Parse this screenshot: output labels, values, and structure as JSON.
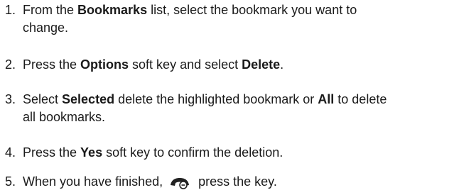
{
  "steps": [
    {
      "number": "1.",
      "line1": [
        "From the ",
        "Bookmarks",
        " list, select the bookmark you want to"
      ],
      "line2": [
        "change."
      ]
    },
    {
      "number": "2.",
      "line1": [
        "Press the ",
        "Options",
        " soft key and select ",
        "Delete",
        "."
      ]
    },
    {
      "number": "3.",
      "line1": [
        "Select ",
        "Selected",
        " delete the highlighted bookmark or ",
        "All",
        " to delete"
      ],
      "line2": [
        "all bookmarks."
      ]
    },
    {
      "number": "4.",
      "line1": [
        "Press the ",
        "Yes",
        " soft key to confirm the deletion."
      ]
    },
    {
      "number": "5.",
      "line1": [
        "When you have finished, ",
        " press the key."
      ],
      "icon": "end-call-key-icon"
    }
  ]
}
